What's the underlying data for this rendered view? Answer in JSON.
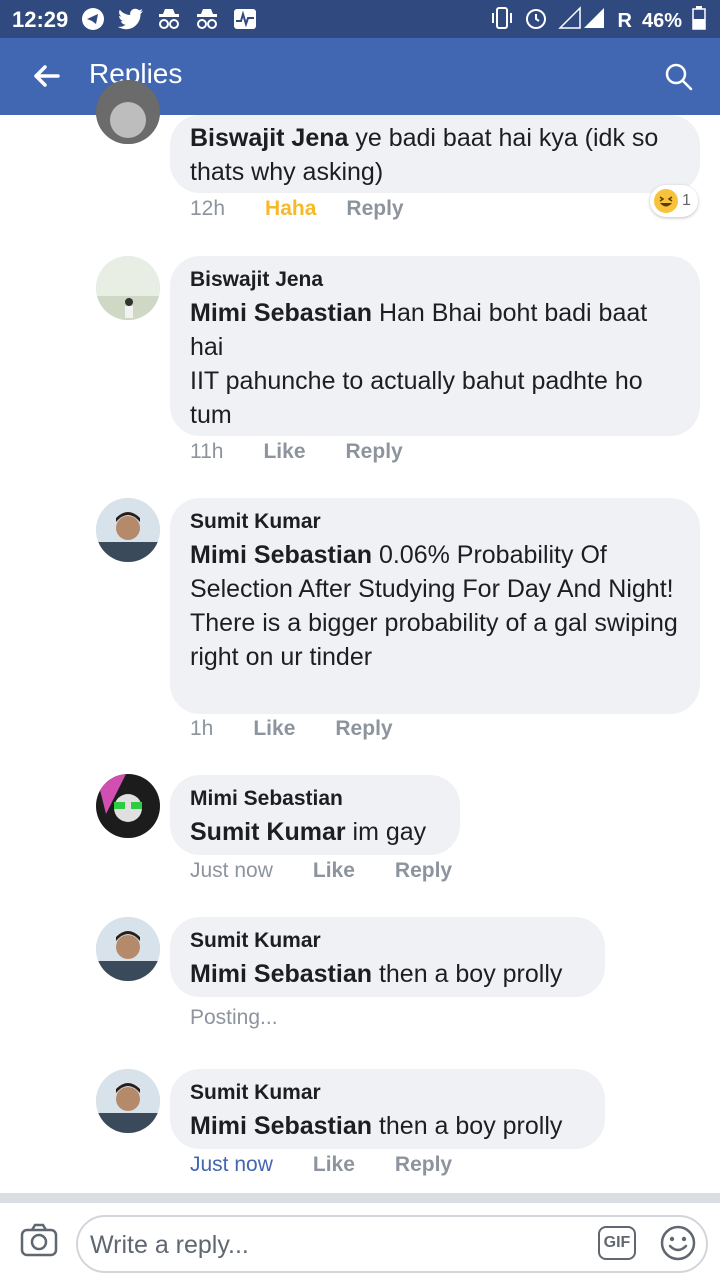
{
  "status_bar": {
    "time": "12:29",
    "carrier": "R",
    "battery": "46%"
  },
  "header": {
    "title": "Replies"
  },
  "comments": [
    {
      "author": "",
      "mention": "Biswajit Jena",
      "text": " ye badi baat hai kya (idk so thats why asking)",
      "time": "12h",
      "reaction_label": "Haha",
      "reply": "Reply",
      "reaction_count": "1"
    },
    {
      "author": "Biswajit Jena",
      "mention": "Mimi Sebastian",
      "text": " Han Bhai boht badi baat hai",
      "text2": "IIT pahunche to actually bahut padhte ho tum",
      "time": "11h",
      "like": "Like",
      "reply": "Reply"
    },
    {
      "author": "Sumit Kumar",
      "mention": "Mimi Sebastian",
      "text": " 0.06% Probability Of Selection After Studying For Day And Night!",
      "text2": "There is a bigger probability of a gal swiping right on ur tinder",
      "time": "1h",
      "like": "Like",
      "reply": "Reply"
    },
    {
      "author": "Mimi Sebastian",
      "mention": "Sumit Kumar",
      "text": " im gay",
      "time": "Just now",
      "like": "Like",
      "reply": "Reply"
    },
    {
      "author": "Sumit Kumar",
      "mention": "Mimi Sebastian",
      "text": " then a boy prolly",
      "status": "Posting..."
    },
    {
      "author": "Sumit Kumar",
      "mention": "Mimi Sebastian",
      "text": " then a boy prolly",
      "time": "Just now",
      "like": "Like",
      "reply": "Reply"
    }
  ],
  "composer": {
    "placeholder": "Write a reply...",
    "gif_label": "GIF"
  },
  "colors": {
    "header": "#4267b2",
    "status_bar": "#30497f",
    "bubble": "#f0f1f4",
    "haha": "#f7b928",
    "link": "#4267b2"
  }
}
